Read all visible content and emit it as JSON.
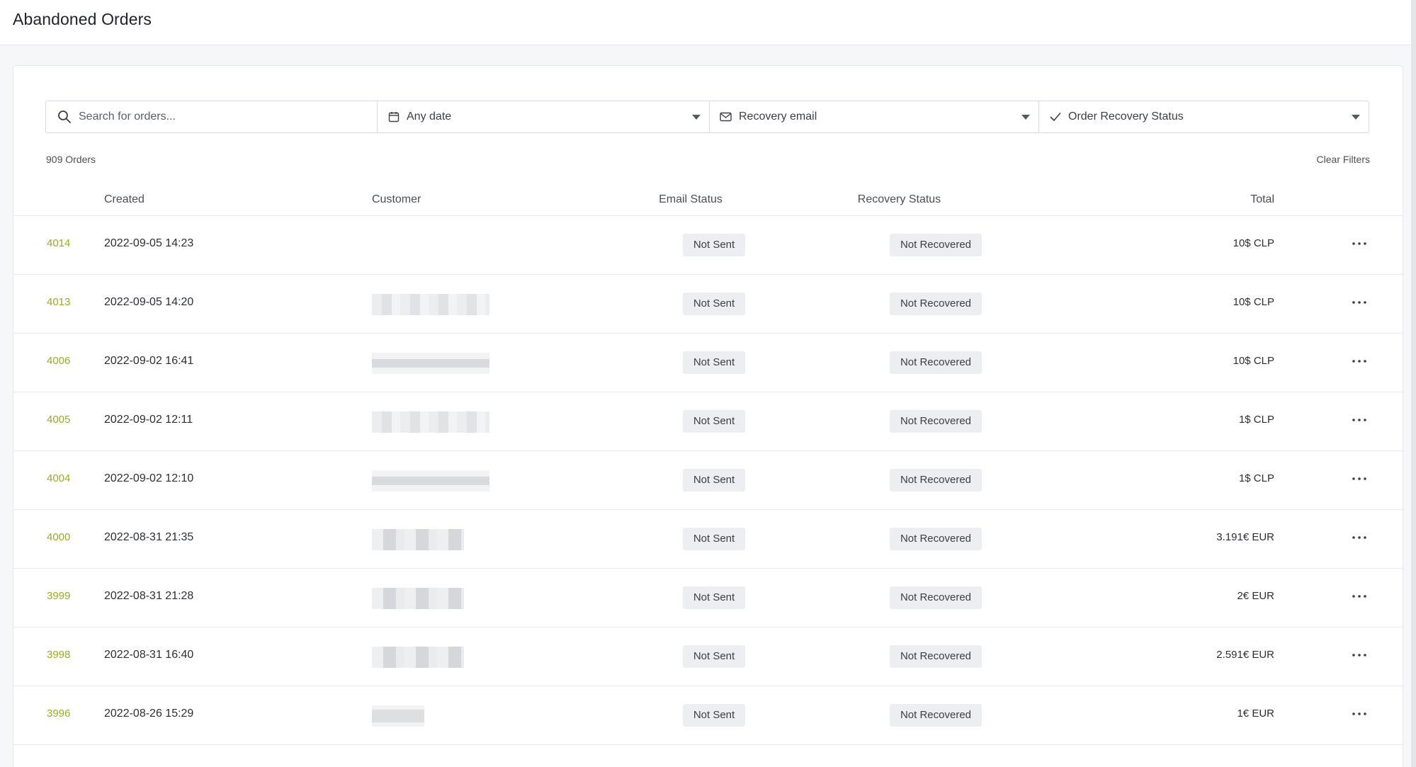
{
  "header": {
    "title": "Abandoned Orders"
  },
  "filters": {
    "search_placeholder": "Search for orders...",
    "date": "Any date",
    "email": "Recovery email",
    "status": "Order Recovery Status"
  },
  "summary": {
    "count": "909 Orders",
    "clear": "Clear Filters"
  },
  "columns": {
    "created": "Created",
    "customer": "Customer",
    "email_status": "Email Status",
    "recovery_status": "Recovery Status",
    "total": "Total"
  },
  "orders": [
    {
      "id": "4014",
      "created": "2022-09-05 14:23",
      "email_status": "Not Sent",
      "recovery_status": "Not Recovered",
      "total": "10$ CLP"
    },
    {
      "id": "4013",
      "created": "2022-09-05 14:20",
      "email_status": "Not Sent",
      "recovery_status": "Not Recovered",
      "total": "10$ CLP"
    },
    {
      "id": "4006",
      "created": "2022-09-02 16:41",
      "email_status": "Not Sent",
      "recovery_status": "Not Recovered",
      "total": "10$ CLP"
    },
    {
      "id": "4005",
      "created": "2022-09-02 12:11",
      "email_status": "Not Sent",
      "recovery_status": "Not Recovered",
      "total": "1$ CLP"
    },
    {
      "id": "4004",
      "created": "2022-09-02 12:10",
      "email_status": "Not Sent",
      "recovery_status": "Not Recovered",
      "total": "1$ CLP"
    },
    {
      "id": "4000",
      "created": "2022-08-31 21:35",
      "email_status": "Not Sent",
      "recovery_status": "Not Recovered",
      "total": "3.191€ EUR"
    },
    {
      "id": "3999",
      "created": "2022-08-31 21:28",
      "email_status": "Not Sent",
      "recovery_status": "Not Recovered",
      "total": "2€ EUR"
    },
    {
      "id": "3998",
      "created": "2022-08-31 16:40",
      "email_status": "Not Sent",
      "recovery_status": "Not Recovered",
      "total": "2.591€ EUR"
    },
    {
      "id": "3996",
      "created": "2022-08-26 15:29",
      "email_status": "Not Sent",
      "recovery_status": "Not Recovered",
      "total": "1€ EUR"
    }
  ],
  "colors": {
    "order_link": "#94b01d",
    "badge_bg": "#eceef1",
    "page_bg": "#f6f7f8"
  },
  "icons": {
    "search": "search-icon",
    "date": "calendar-icon",
    "email": "envelope-icon",
    "status": "check-icon",
    "row_action": "more-horizontal-icon"
  }
}
